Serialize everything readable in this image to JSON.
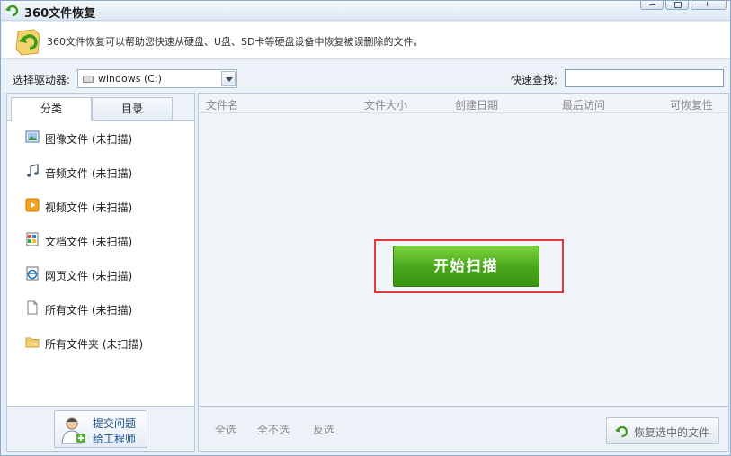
{
  "window": {
    "title": "360文件恢复"
  },
  "banner": {
    "text": "360文件恢复可以帮助您快速从硬盘、U盘、SD卡等硬盘设备中恢复被误删除的文件。"
  },
  "drive": {
    "label": "选择驱动器:",
    "value": "windows (C:)"
  },
  "search": {
    "label": "快速查找:",
    "value": "",
    "placeholder": ""
  },
  "tabs": [
    {
      "label": "分类",
      "active": true
    },
    {
      "label": "目录",
      "active": false
    }
  ],
  "categories": [
    {
      "label": "图像文件 (未扫描)",
      "icon": "image-icon"
    },
    {
      "label": "音频文件 (未扫描)",
      "icon": "audio-icon"
    },
    {
      "label": "视频文件 (未扫描)",
      "icon": "video-icon"
    },
    {
      "label": "文档文件 (未扫描)",
      "icon": "document-icon"
    },
    {
      "label": "网页文件 (未扫描)",
      "icon": "webpage-icon"
    },
    {
      "label": "所有文件 (未扫描)",
      "icon": "file-icon"
    },
    {
      "label": "所有文件夹 (未扫描)",
      "icon": "folder-icon"
    }
  ],
  "feedback": {
    "line1": "提交问题",
    "line2": "给工程师"
  },
  "columns": [
    "文件名",
    "文件大小",
    "创建日期",
    "最后访问",
    "可恢复性"
  ],
  "scan": {
    "label": "开始扫描"
  },
  "selection": {
    "select_all": "全选",
    "select_none": "全不选",
    "invert": "反选"
  },
  "recover": {
    "label": "恢复选中的文件"
  }
}
